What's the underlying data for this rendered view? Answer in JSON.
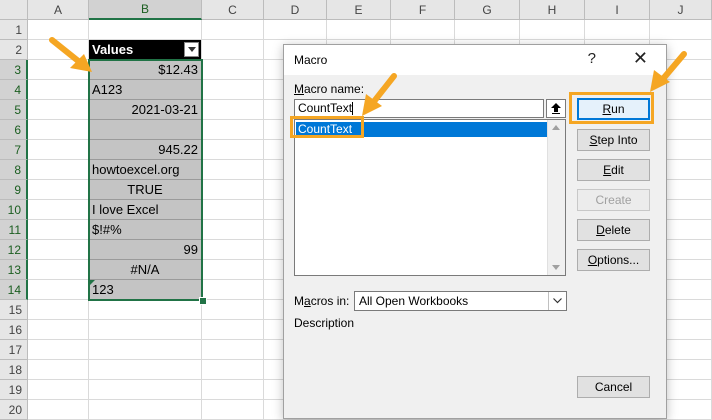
{
  "spreadsheet": {
    "columns": [
      "A",
      "B",
      "C",
      "D",
      "E",
      "F",
      "G",
      "H",
      "I",
      "J"
    ],
    "rows": [
      "1",
      "2",
      "3",
      "4",
      "5",
      "6",
      "7",
      "8",
      "9",
      "10",
      "11",
      "12",
      "13",
      "14",
      "15",
      "16",
      "17",
      "18",
      "19",
      "20"
    ],
    "header_cell": "Values",
    "values": [
      "$12.43",
      "A123",
      "2021-03-21",
      "",
      "945.22",
      "howtoexcel.org",
      "TRUE",
      "I love Excel",
      "$!#%",
      "99",
      "#N/A",
      "123"
    ]
  },
  "dialog": {
    "title": "Macro",
    "help": "?",
    "close": "✕",
    "macro_name_label_underlined": "M",
    "macro_name_label_rest": "acro name:",
    "macro_name_value": "CountText",
    "macro_list": [
      "CountText"
    ],
    "macros_in_label_prefix": "M",
    "macros_in_label_underlined": "a",
    "macros_in_label_rest": "cros in:",
    "macros_in_value": "All Open Workbooks",
    "description_label": "Description",
    "buttons": {
      "run_u": "R",
      "run_rest": "un",
      "step_into_u": "S",
      "step_into_rest": "tep Into",
      "edit_u": "E",
      "edit_rest": "dit",
      "create": "Create",
      "delete_u": "D",
      "delete_rest": "elete",
      "options_u": "O",
      "options_rest": "ptions...",
      "cancel": "Cancel"
    }
  },
  "colors": {
    "highlight": "#f5a623",
    "selection": "#217346",
    "list_selected": "#0078d7"
  }
}
